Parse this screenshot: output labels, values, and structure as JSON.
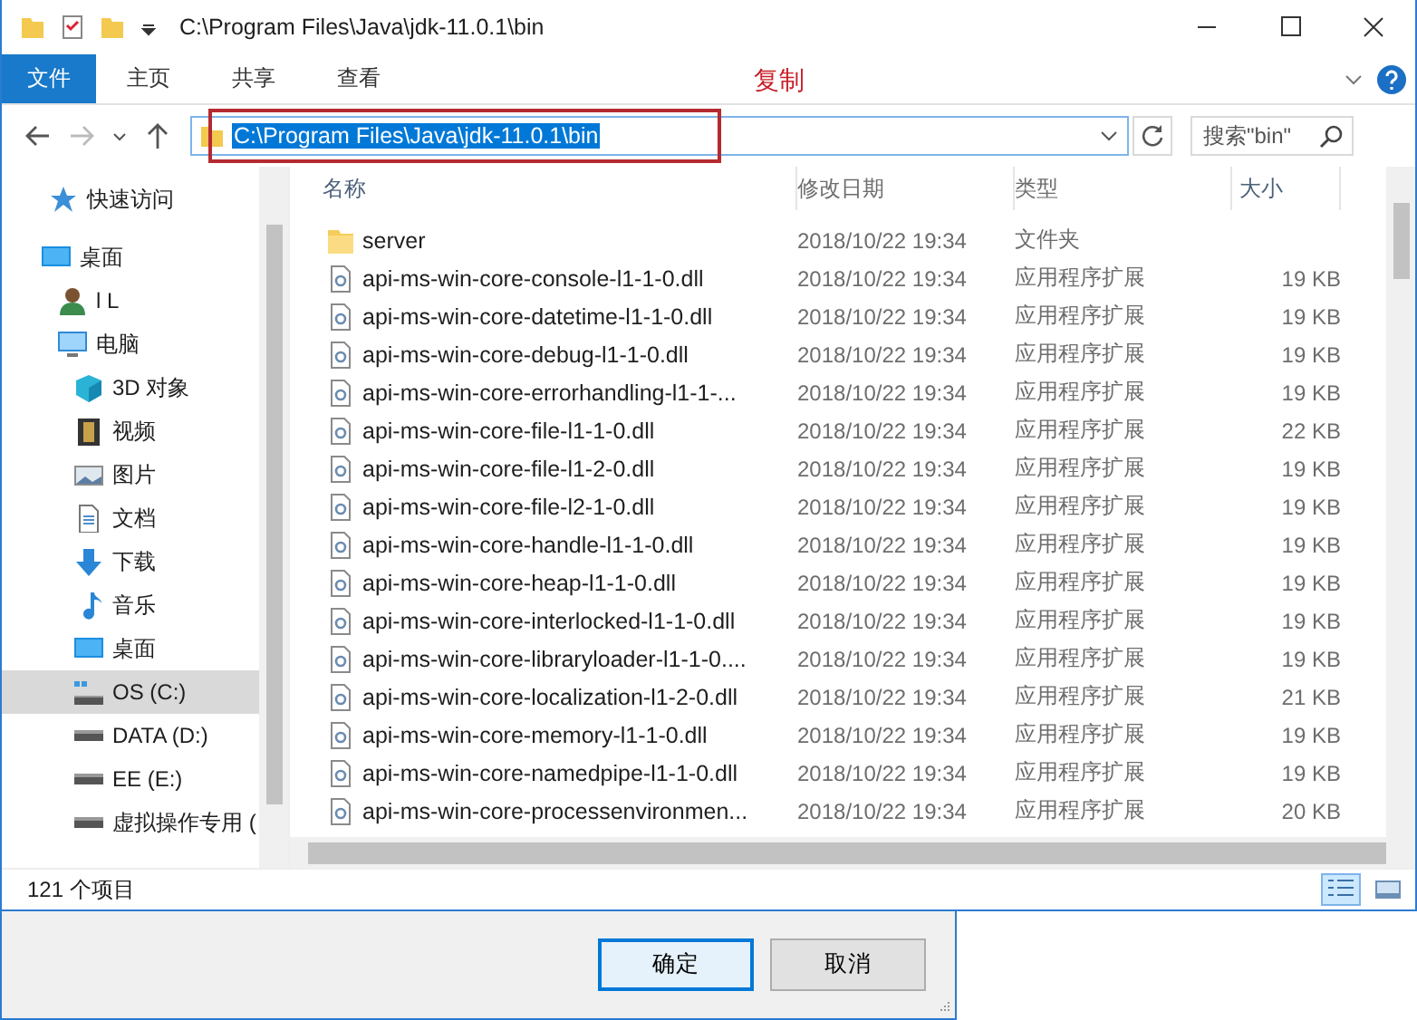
{
  "window": {
    "title": "C:\\Program Files\\Java\\jdk-11.0.1\\bin"
  },
  "ribbon": {
    "tabs": [
      {
        "label": "文件",
        "selected": true
      },
      {
        "label": "主页",
        "selected": false
      },
      {
        "label": "共享",
        "selected": false
      },
      {
        "label": "查看",
        "selected": false
      }
    ]
  },
  "annotation": {
    "text": "复制"
  },
  "address_bar": {
    "value": "C:\\Program Files\\Java\\jdk-11.0.1\\bin",
    "selected": true
  },
  "search": {
    "placeholder": "搜索\"bin\""
  },
  "sidebar": {
    "items": [
      {
        "kind": "star",
        "label": "快速访问",
        "selected": false
      },
      {
        "kind": "desktop",
        "label": "桌面",
        "selected": false,
        "children": [
          {
            "kind": "user",
            "label": "l L",
            "selected": false
          },
          {
            "kind": "pc",
            "label": "电脑",
            "selected": false,
            "children": [
              {
                "kind": "cube",
                "label": "3D 对象",
                "selected": false
              },
              {
                "kind": "film",
                "label": "视频",
                "selected": false
              },
              {
                "kind": "image",
                "label": "图片",
                "selected": false
              },
              {
                "kind": "doc",
                "label": "文档",
                "selected": false
              },
              {
                "kind": "download",
                "label": "下载",
                "selected": false
              },
              {
                "kind": "music",
                "label": "音乐",
                "selected": false
              },
              {
                "kind": "desktop",
                "label": "桌面",
                "selected": false
              },
              {
                "kind": "osdrive",
                "label": "OS (C:)",
                "selected": true
              },
              {
                "kind": "drive",
                "label": "DATA (D:)",
                "selected": false
              },
              {
                "kind": "drive",
                "label": "EE (E:)",
                "selected": false
              },
              {
                "kind": "drive",
                "label": "虚拟操作专用 (",
                "selected": false
              }
            ]
          }
        ]
      }
    ]
  },
  "file_list": {
    "columns": [
      "名称",
      "修改日期",
      "类型",
      "大小"
    ],
    "rows": [
      {
        "kind": "folder",
        "name": "server",
        "modified": "2018/10/22 19:34",
        "type": "文件夹"
      },
      {
        "kind": "dll",
        "name": "api-ms-win-core-console-l1-1-0.dll",
        "modified": "2018/10/22 19:34",
        "type": "应用程序扩展",
        "size": "19 KB"
      },
      {
        "kind": "dll",
        "name": "api-ms-win-core-datetime-l1-1-0.dll",
        "modified": "2018/10/22 19:34",
        "type": "应用程序扩展",
        "size": "19 KB"
      },
      {
        "kind": "dll",
        "name": "api-ms-win-core-debug-l1-1-0.dll",
        "modified": "2018/10/22 19:34",
        "type": "应用程序扩展",
        "size": "19 KB"
      },
      {
        "kind": "dll",
        "name": "api-ms-win-core-errorhandling-l1-1-...",
        "modified": "2018/10/22 19:34",
        "type": "应用程序扩展",
        "size": "19 KB"
      },
      {
        "kind": "dll",
        "name": "api-ms-win-core-file-l1-1-0.dll",
        "modified": "2018/10/22 19:34",
        "type": "应用程序扩展",
        "size": "22 KB"
      },
      {
        "kind": "dll",
        "name": "api-ms-win-core-file-l1-2-0.dll",
        "modified": "2018/10/22 19:34",
        "type": "应用程序扩展",
        "size": "19 KB"
      },
      {
        "kind": "dll",
        "name": "api-ms-win-core-file-l2-1-0.dll",
        "modified": "2018/10/22 19:34",
        "type": "应用程序扩展",
        "size": "19 KB"
      },
      {
        "kind": "dll",
        "name": "api-ms-win-core-handle-l1-1-0.dll",
        "modified": "2018/10/22 19:34",
        "type": "应用程序扩展",
        "size": "19 KB"
      },
      {
        "kind": "dll",
        "name": "api-ms-win-core-heap-l1-1-0.dll",
        "modified": "2018/10/22 19:34",
        "type": "应用程序扩展",
        "size": "19 KB"
      },
      {
        "kind": "dll",
        "name": "api-ms-win-core-interlocked-l1-1-0.dll",
        "modified": "2018/10/22 19:34",
        "type": "应用程序扩展",
        "size": "19 KB"
      },
      {
        "kind": "dll",
        "name": "api-ms-win-core-libraryloader-l1-1-0....",
        "modified": "2018/10/22 19:34",
        "type": "应用程序扩展",
        "size": "19 KB"
      },
      {
        "kind": "dll",
        "name": "api-ms-win-core-localization-l1-2-0.dll",
        "modified": "2018/10/22 19:34",
        "type": "应用程序扩展",
        "size": "21 KB"
      },
      {
        "kind": "dll",
        "name": "api-ms-win-core-memory-l1-1-0.dll",
        "modified": "2018/10/22 19:34",
        "type": "应用程序扩展",
        "size": "19 KB"
      },
      {
        "kind": "dll",
        "name": "api-ms-win-core-namedpipe-l1-1-0.dll",
        "modified": "2018/10/22 19:34",
        "type": "应用程序扩展",
        "size": "19 KB"
      },
      {
        "kind": "dll",
        "name": "api-ms-win-core-processenvironmen...",
        "modified": "2018/10/22 19:34",
        "type": "应用程序扩展",
        "size": "20 KB"
      }
    ]
  },
  "status_bar": {
    "count": "121 个项目",
    "views": [
      {
        "kind": "details",
        "selected": true
      },
      {
        "kind": "thumbnails",
        "selected": false
      }
    ]
  },
  "dialog": {
    "buttons": [
      {
        "label": "确定",
        "default": true
      },
      {
        "label": "取消",
        "default": false
      }
    ]
  }
}
